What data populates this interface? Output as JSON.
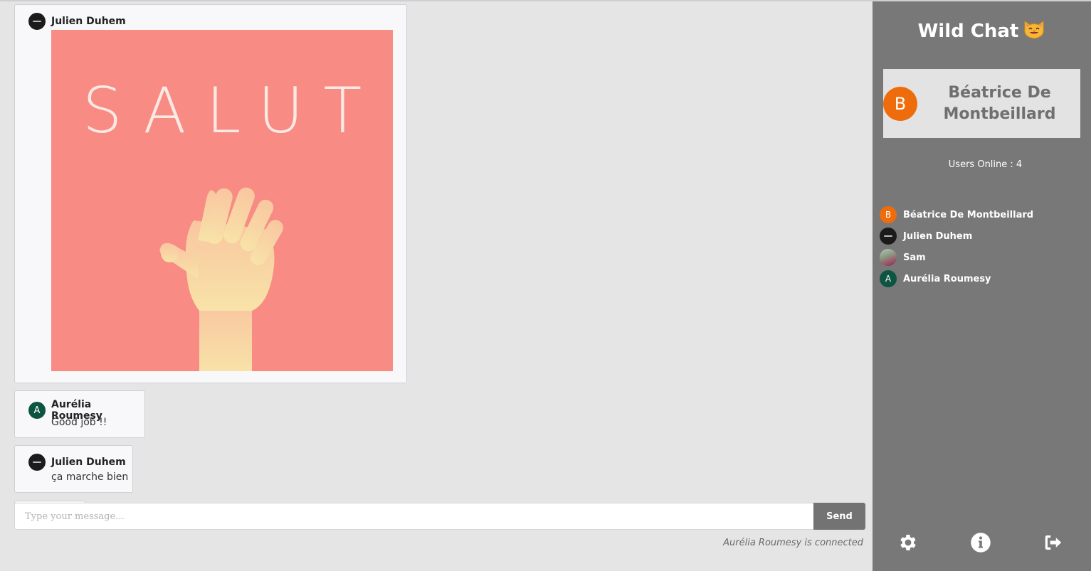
{
  "messages": [
    {
      "author": "Julien Duhem",
      "avatar": "dark-logo",
      "image": {
        "caption_text": "SALUT",
        "background": "#f88b84"
      }
    },
    {
      "author": "Aurélia Roumesy",
      "avatar_letter": "A",
      "text": "Good job !!"
    },
    {
      "author": "Julien Duhem",
      "avatar": "dark-logo",
      "text": "ça marche bien"
    }
  ],
  "composer": {
    "placeholder": "Type your message...",
    "send_label": "Send"
  },
  "status_text": "Aurélia Roumesy is connected",
  "sidebar": {
    "title": "Wild Chat",
    "title_emoji": "smiling-cat-icon",
    "current_user": {
      "letter": "B",
      "name": "Béatrice De Montbeillard",
      "color": "#ef6c0c"
    },
    "users_online_label": "Users Online : 4",
    "users": [
      {
        "name": "Béatrice De Montbeillard",
        "letter": "B",
        "color": "#ef6c0c"
      },
      {
        "name": "Julien Duhem",
        "letter": "",
        "color": "#1b1b1b"
      },
      {
        "name": "Sam",
        "letter": "",
        "color": "photo"
      },
      {
        "name": "Aurélia Roumesy",
        "letter": "A",
        "color": "#0d5540"
      }
    ],
    "footer_icons": [
      "gear-icon",
      "info-icon",
      "logout-icon"
    ]
  },
  "colors": {
    "sidebar_bg": "#787878",
    "chat_bg": "#e5e5e5",
    "send_button": "#737373"
  }
}
